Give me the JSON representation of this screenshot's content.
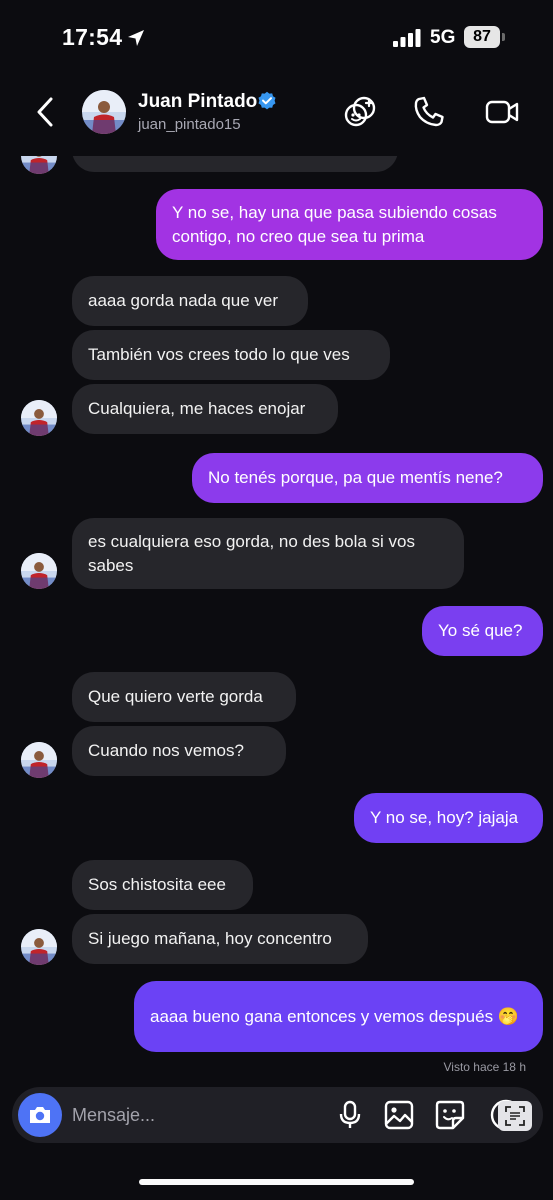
{
  "status_bar": {
    "time": "17:54",
    "network": "5G",
    "battery": "87"
  },
  "header": {
    "name": "Juan Pintado",
    "username": "juan_pintado15"
  },
  "messages": [
    {
      "text": "Y no se, hay una que pasa subiendo cosas contigo, no creo que sea tu prima",
      "from": "me"
    },
    {
      "text": "aaaa gorda nada que ver",
      "from": "them"
    },
    {
      "text": "También vos crees todo lo que ves",
      "from": "them"
    },
    {
      "text": "Cualquiera, me haces enojar",
      "from": "them"
    },
    {
      "text": "No tenés porque, pa que mentís nene?",
      "from": "me"
    },
    {
      "text": "es cualquiera eso gorda, no des bola si vos sabes",
      "from": "them"
    },
    {
      "text": "Yo sé que?",
      "from": "me"
    },
    {
      "text": "Que quiero verte gorda",
      "from": "them"
    },
    {
      "text": "Cuando nos vemos?",
      "from": "them"
    },
    {
      "text": "Y no se, hoy? jajaja",
      "from": "me"
    },
    {
      "text": "Sos chistosita eee",
      "from": "them"
    },
    {
      "text": "Si juego mañana, hoy concentro",
      "from": "them"
    },
    {
      "text": "aaaa bueno gana entonces y vemos después 🤭",
      "from": "me"
    }
  ],
  "seen_receipt": "Visto hace 18 h",
  "composer": {
    "placeholder": "Mensaje..."
  },
  "colors": {
    "incoming_bubble": "#26262b",
    "outgoing_top": "#a233e3",
    "outgoing_bottom": "#6b42f5",
    "camera_button": "#4e73f5",
    "verified_badge": "#3797f0"
  },
  "icons": [
    "back-chevron-icon",
    "verified-badge-icon",
    "effects-icon",
    "phone-icon",
    "video-camera-icon",
    "camera-icon",
    "microphone-icon",
    "gallery-icon",
    "sticker-icon",
    "plus-icon"
  ]
}
